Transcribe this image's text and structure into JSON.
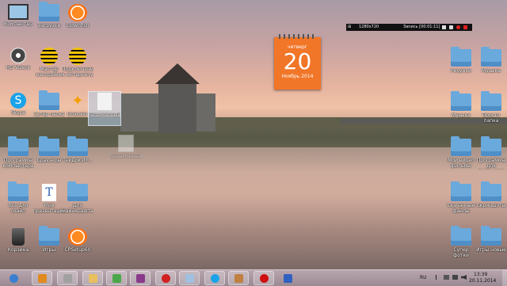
{
  "desktop": {
    "icons_left": [
      {
        "label": "Компьютер",
        "icon": "computer-icon"
      },
      {
        "label": "Загрузки",
        "icon": "folder-icon"
      },
      {
        "label": "Clownfish",
        "icon": "clownfish-icon"
      },
      {
        "label": "HD VDeck",
        "icon": "speaker-icon"
      },
      {
        "label": "Мастер настройки",
        "icon": "beeline-icon"
      },
      {
        "label": "Подключение к интернету",
        "icon": "beeline-icon"
      },
      {
        "label": "Skype",
        "icon": "skype-icon"
      },
      {
        "label": "Супер папка",
        "icon": "folder-icon"
      },
      {
        "label": "Unlocker",
        "icon": "unlocker-icon"
      },
      {
        "label": "Программы компьютера",
        "icon": "folder-icon"
      },
      {
        "label": "Браузеры",
        "icon": "folder-icon"
      },
      {
        "label": "ТекДокуМ...",
        "icon": "folder-icon"
      },
      {
        "label": "Всё для скайп",
        "icon": "folder-icon"
      },
      {
        "label": "Мои презентации",
        "icon": "word-doc-icon"
      },
      {
        "label": "Для майнкрафта",
        "icon": "folder-icon"
      },
      {
        "label": "Корзина",
        "icon": "recycle-bin-icon"
      },
      {
        "label": "Игры",
        "icon": "folder-icon"
      },
      {
        "label": "CPSetup60",
        "icon": "clownfish-icon"
      }
    ],
    "selected_icon": {
      "label": "Безымянный.txt"
    },
    "drag_ghost": {
      "label": "Безымянный.txt"
    },
    "icons_right": [
      {
        "label": "Рисунки",
        "icon": "folder-icon"
      },
      {
        "label": "Музыка",
        "icon": "folder-icon"
      },
      {
        "label": "Музыка",
        "icon": "folder-icon"
      },
      {
        "label": "Просто папка",
        "icon": "folder-icon"
      },
      {
        "label": "Мои видео фильмы",
        "icon": "folder-icon"
      },
      {
        "label": "Программы для фотошопа",
        "icon": "folder-icon"
      },
      {
        "label": "Скачанные файлы",
        "icon": "folder-icon"
      },
      {
        "label": "Скриншоты",
        "icon": "folder-icon"
      },
      {
        "label": "Супер фотки",
        "icon": "folder-icon"
      },
      {
        "label": "Игры новые",
        "icon": "folder-icon"
      }
    ]
  },
  "calendar": {
    "weekday": "четверг",
    "day": "20",
    "month_year": "Ноябрь 2014"
  },
  "recorder": {
    "resolution": "1280x720",
    "status": "Запись [00:01:11]",
    "colors": {
      "bg": "#111111",
      "rec": "#e02020"
    }
  },
  "taskbar": {
    "buttons": [
      {
        "name": "start-button",
        "icon": "windows-orb-icon"
      },
      {
        "name": "media-player-button",
        "icon": "play-icon"
      },
      {
        "name": "calculator-button",
        "icon": "calculator-icon"
      },
      {
        "name": "explorer-button",
        "icon": "folder-icon"
      },
      {
        "name": "chrome-button",
        "icon": "chrome-icon"
      },
      {
        "name": "winrar-button",
        "icon": "archive-icon"
      },
      {
        "name": "opera-button",
        "icon": "opera-icon"
      },
      {
        "name": "paint-button",
        "icon": "paint-icon"
      },
      {
        "name": "skype-button",
        "icon": "skype-icon"
      },
      {
        "name": "game-button",
        "icon": "game-icon"
      },
      {
        "name": "recorder-button",
        "icon": "record-icon"
      },
      {
        "name": "notepad-button",
        "icon": "notepad-icon"
      }
    ],
    "tray": {
      "language": "RU",
      "time": "13:39",
      "date": "20.11.2014"
    }
  }
}
